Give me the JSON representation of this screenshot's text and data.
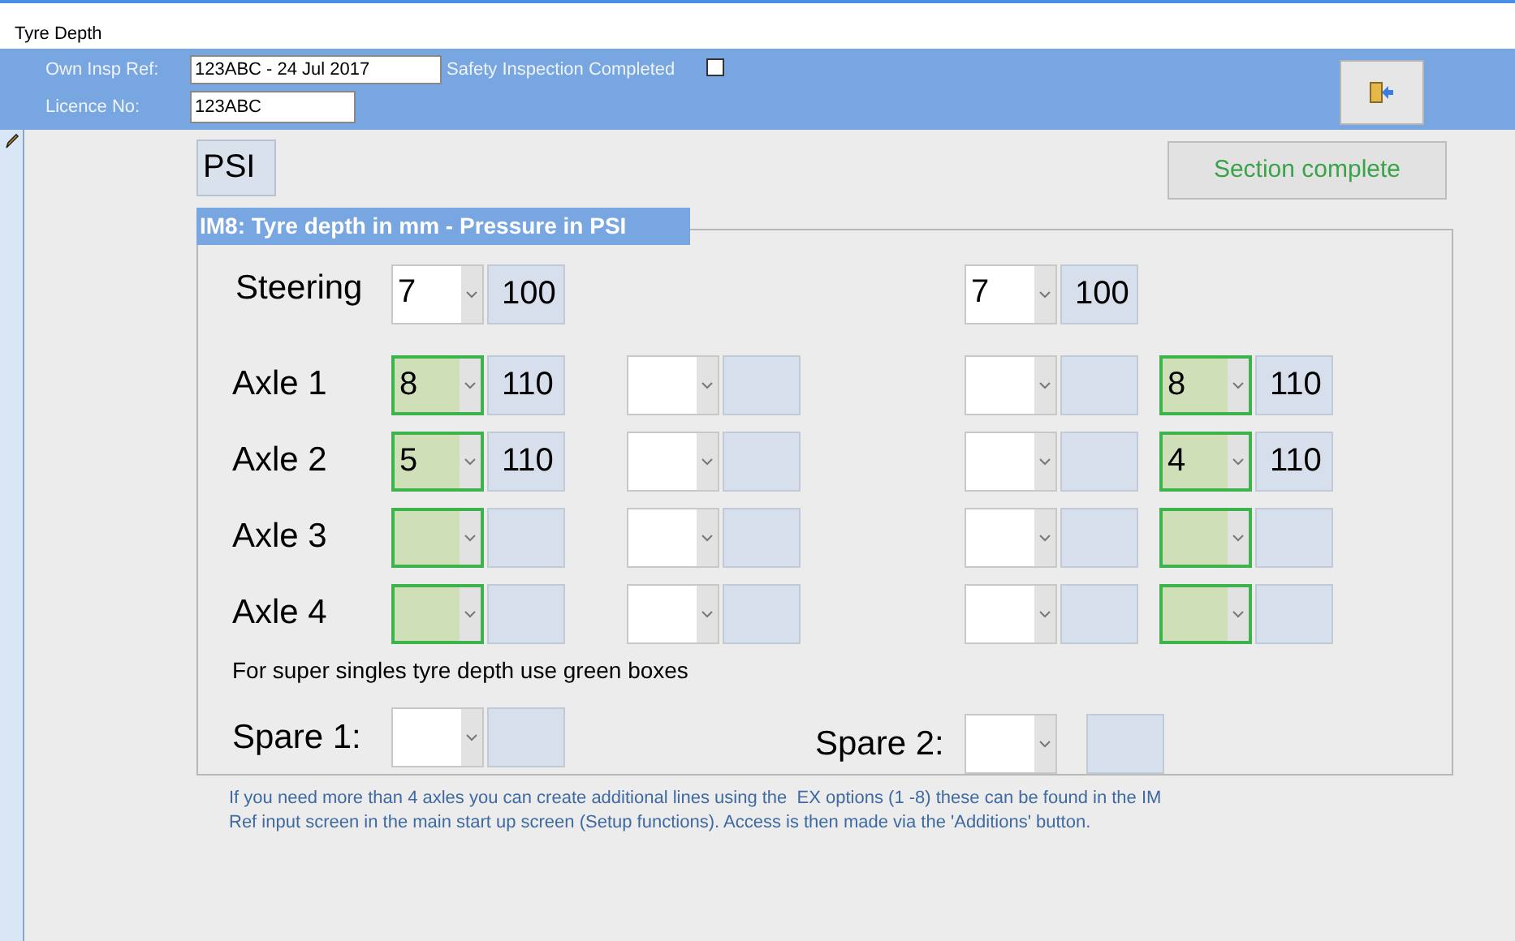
{
  "window": {
    "title": "Tyre Depth"
  },
  "header": {
    "own_insp_ref": {
      "label": "Own Insp Ref:",
      "value": "123ABC - 24 Jul 2017"
    },
    "safety_inspection": {
      "label": "Safety Inspection Completed",
      "checked": false
    },
    "licence_no": {
      "label": "Licence No:",
      "value": "123ABC"
    }
  },
  "unit_label": "PSI",
  "section_complete_button": "Section complete",
  "group": {
    "title": "IM8: Tyre depth in mm - Pressure in PSI",
    "rows": [
      {
        "label": "Steering",
        "kind": "steering",
        "wheels": [
          {
            "kind": "wheel",
            "depth": "7",
            "pressure": "100",
            "super_single": false
          },
          {
            "kind": "none"
          },
          {
            "kind": "wheel",
            "depth": "7",
            "pressure": "100",
            "super_single": false
          },
          {
            "kind": "none"
          }
        ]
      },
      {
        "label": "Axle 1",
        "kind": "axle",
        "wheels": [
          {
            "kind": "wheel",
            "depth": "8",
            "pressure": "110",
            "super_single": true
          },
          {
            "kind": "wheel",
            "super_single": false
          },
          {
            "kind": "wheel",
            "super_single": false
          },
          {
            "kind": "wheel",
            "depth": "8",
            "pressure": "110",
            "super_single": true
          }
        ]
      },
      {
        "label": "Axle 2",
        "kind": "axle",
        "wheels": [
          {
            "kind": "wheel",
            "depth": "5",
            "pressure": "110",
            "super_single": true
          },
          {
            "kind": "wheel",
            "super_single": false
          },
          {
            "kind": "wheel",
            "super_single": false
          },
          {
            "kind": "wheel",
            "depth": "4",
            "pressure": "110",
            "super_single": true
          }
        ]
      },
      {
        "label": "Axle 3",
        "kind": "axle",
        "wheels": [
          {
            "kind": "wheel",
            "super_single": true
          },
          {
            "kind": "wheel",
            "super_single": false
          },
          {
            "kind": "wheel",
            "super_single": false
          },
          {
            "kind": "wheel",
            "super_single": true
          }
        ]
      },
      {
        "label": "Axle 4",
        "kind": "axle",
        "wheels": [
          {
            "kind": "wheel",
            "super_single": true
          },
          {
            "kind": "wheel",
            "super_single": false
          },
          {
            "kind": "wheel",
            "super_single": false
          },
          {
            "kind": "wheel",
            "super_single": true
          }
        ]
      }
    ],
    "note": "For super singles tyre depth use green boxes",
    "spares": [
      {
        "label": "Spare 1:"
      },
      {
        "label": "Spare 2:"
      }
    ]
  },
  "footer_note": "If you need more than 4 axles you can create additional lines using the  EX options (1 -8) these can be found in the IM Ref input screen in the main start up screen (Setup functions). Access is then made via the 'Additions' button."
}
